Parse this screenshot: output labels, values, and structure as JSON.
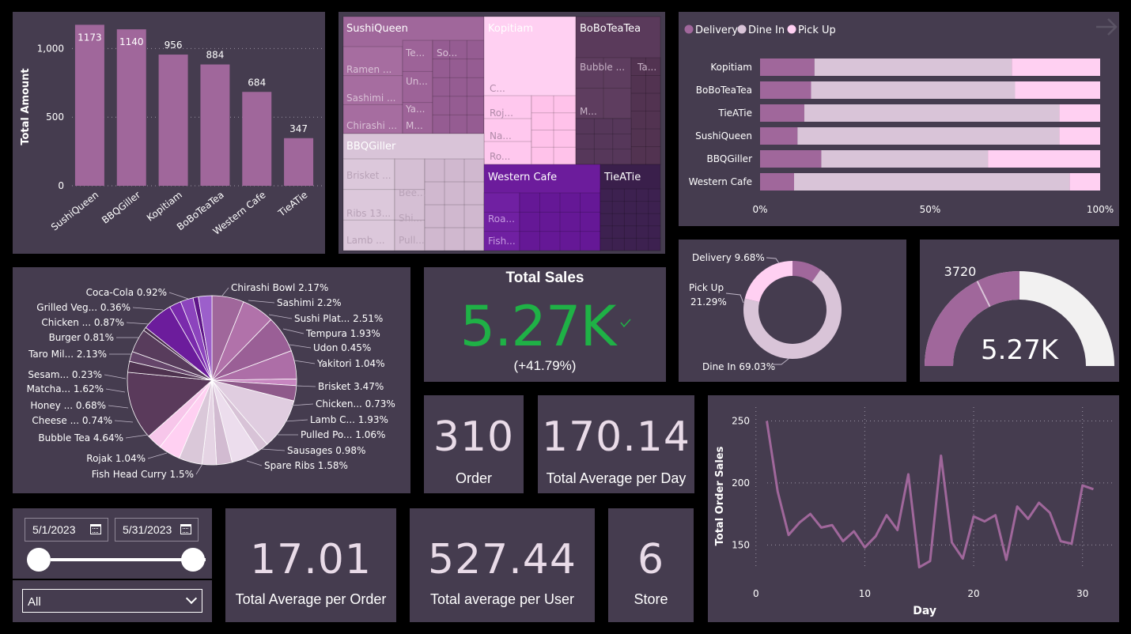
{
  "colors": {
    "panel": "#453c4f",
    "bar": "#a0679b",
    "delivery": "#a0679b",
    "dine_in": "#d9c4d8",
    "pick_up": "#ffd0f2",
    "kpi_green": "#1fb146",
    "gauge_bg": "#f2f1f1",
    "line": "#a0679b"
  },
  "store_bar_chart": {
    "ylabel": "Total Amount",
    "y_ticks": [
      "0",
      "500",
      "1,000"
    ]
  },
  "treemap": {
    "labels": {
      "sushiqueen": "SushiQueen",
      "kopitiam": "Kopitiam",
      "boboteatea": "BoBoTeaTea",
      "bbqgiller": "BBQGiller",
      "western_cafe": "Western Cafe",
      "tieatie": "TieATie",
      "te": "Te...",
      "so": "So...",
      "ramen": "Ramen ...",
      "un": "Un...",
      "sashimi": "Sashimi ...",
      "ya": "Ya...",
      "chirashi": "Chirashi ...",
      "m": "M...",
      "c": "C...",
      "roj": "Roj...",
      "na": "Na...",
      "ro": "Ro...",
      "bubble": "Bubble ...",
      "ta": "Ta...",
      "m2": "M...",
      "brisket": "Brisket ...",
      "bee": "Bee...",
      "ribs": "Ribs 13...",
      "shi": "Shi...",
      "lamb": "Lamb ...",
      "pull": "Pull...",
      "roa": "Roa...",
      "fish": "Fish..."
    }
  },
  "order_type_legend": {
    "delivery": "Delivery",
    "dine_in": "Dine In",
    "pick_up": "Pick Up"
  },
  "pie_labels": {
    "chirashi_bowl": "Chirashi Bowl 2.17%",
    "sashimi": "Sashimi 2.2%",
    "sushi_plat": "Sushi Plat... 2.51%",
    "tempura": "Tempura 1.93%",
    "udon": "Udon 0.45%",
    "yakitori": "Yakitori 1.04%",
    "brisket": "Brisket 3.47%",
    "chicken_r": "Chicken... 0.73%",
    "lamb_c": "Lamb C... 1.93%",
    "pulled_po": "Pulled Po... 1.06%",
    "sausages": "Sausages 0.98%",
    "spare_ribs": "Spare Ribs 1.58%",
    "fish_head_curry": "Fish Head Curry 1.5%",
    "rojak": "Rojak 1.04%",
    "bubble_tea": "Bubble Tea 4.64%",
    "cheese": "Cheese ... 0.74%",
    "honey": "Honey ... 0.68%",
    "matcha": "Matcha... 1.62%",
    "sesam": "Sesam... 0.23%",
    "taro_mil": "Taro Mil... 2.13%",
    "burger": "Burger 0.81%",
    "chicken_l": "Chicken ... 0.87%",
    "grilled_veg": "Grilled Veg... 0.36%",
    "coca_cola": "Coca-Cola 0.92%"
  },
  "kpi_total_sales": {
    "title": "Total Sales",
    "value": "5.27K",
    "change": "(+41.79%)"
  },
  "donut_labels": {
    "delivery": "Delivery 9.68%",
    "pick_up_name": "Pick Up",
    "pick_up_pct": "21.29%",
    "dine_in": "Dine In 69.03%"
  },
  "gauge": {
    "target_label": "3720",
    "value_label": "5.27K"
  },
  "cards": {
    "order": {
      "value": "310",
      "label": "Order"
    },
    "avg_day": {
      "value": "170.14",
      "label": "Total Average per Day"
    },
    "avg_order": {
      "value": "17.01",
      "label": "Total Average per Order"
    },
    "avg_user": {
      "value": "527.44",
      "label": "Total average per User"
    },
    "store": {
      "value": "6",
      "label": "Store"
    }
  },
  "date_filter": {
    "start": "5/1/2023",
    "end": "5/31/2023"
  },
  "store_filter": {
    "selected": "All"
  },
  "chart_data": [
    {
      "type": "bar",
      "ylabel": "Total Amount",
      "categories": [
        "SushiQueen",
        "BBQGiller",
        "Kopitiam",
        "BoBoTeaTea",
        "Western Cafe",
        "TieATie"
      ],
      "values": [
        1173,
        1140,
        956,
        884,
        684,
        347
      ],
      "ylim": [
        0,
        1250
      ],
      "grid": true
    },
    {
      "type": "bar",
      "stacked": "100%",
      "orientation": "horizontal",
      "categories": [
        "Kopitiam",
        "BoBoTeaTea",
        "TieATie",
        "SushiQueen",
        "BBQGiller",
        "Western Cafe"
      ],
      "series": [
        {
          "name": "Delivery",
          "values": [
            16,
            15,
            13,
            11,
            18,
            10
          ]
        },
        {
          "name": "Dine In",
          "values": [
            58,
            60,
            75,
            77,
            49,
            81
          ]
        },
        {
          "name": "Pick Up",
          "values": [
            26,
            25,
            12,
            12,
            33,
            9
          ]
        }
      ],
      "x_ticks": [
        "0%",
        "50%",
        "100%"
      ],
      "legend": "top-left"
    },
    {
      "type": "pie",
      "labels": [
        "Chirashi Bowl",
        "Sashimi",
        "Sushi Plat...",
        "Tempura",
        "Udon",
        "Yakitori",
        "Brisket",
        "Chicken...",
        "Lamb C...",
        "Pulled Po...",
        "Sausages",
        "Spare Ribs",
        "Fish Head Curry",
        "Rojak",
        "Bubble Tea",
        "Cheese ...",
        "Honey ...",
        "Matcha...",
        "Sesam...",
        "Taro Mil...",
        "Burger",
        "Chicken ...",
        "Grilled Veg...",
        "Coca-Cola"
      ],
      "values": [
        2.17,
        2.2,
        2.51,
        1.93,
        0.45,
        1.04,
        3.47,
        0.73,
        1.93,
        1.06,
        0.98,
        1.58,
        1.5,
        1.04,
        4.64,
        0.74,
        0.68,
        1.62,
        0.23,
        2.13,
        0.81,
        0.87,
        0.36,
        0.92
      ]
    },
    {
      "type": "pie",
      "donut": true,
      "labels": [
        "Delivery",
        "Dine In",
        "Pick Up"
      ],
      "values": [
        9.68,
        69.03,
        21.29
      ]
    },
    {
      "type": "gauge",
      "value": 5270,
      "target": 3720,
      "max": 10540
    },
    {
      "type": "line",
      "xlabel": "Day",
      "ylabel": "Total Order Sales",
      "x": [
        1,
        2,
        3,
        4,
        5,
        6,
        7,
        8,
        9,
        10,
        11,
        12,
        13,
        14,
        15,
        16,
        17,
        18,
        19,
        20,
        21,
        22,
        23,
        24,
        25,
        26,
        27,
        28,
        29,
        30,
        31
      ],
      "values": [
        250,
        193,
        158,
        168,
        175,
        164,
        166,
        153,
        161,
        148,
        157,
        174,
        162,
        207,
        132,
        137,
        222,
        152,
        139,
        173,
        169,
        174,
        138,
        181,
        171,
        184,
        176,
        153,
        151,
        198,
        195
      ],
      "xlim": [
        -1,
        33
      ],
      "ylim": [
        140,
        258
      ],
      "x_ticks": [
        0,
        10,
        20,
        30
      ],
      "y_ticks": [
        150,
        200,
        250
      ],
      "grid": true
    }
  ]
}
